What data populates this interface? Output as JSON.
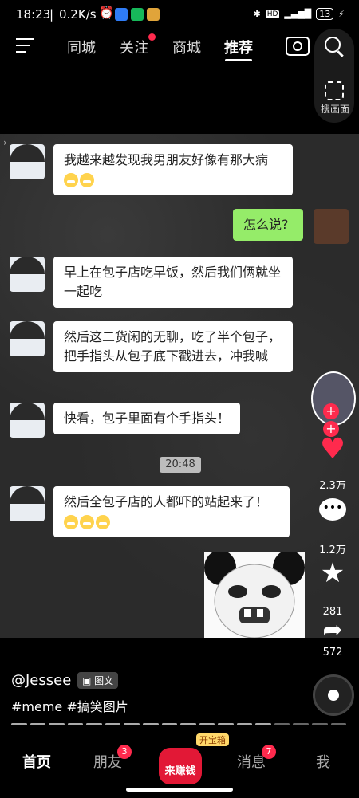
{
  "status_bar": {
    "time": "18:23",
    "speed": "0.2K/s",
    "battery": "13"
  },
  "top_nav": {
    "tabs": [
      {
        "label": "同城"
      },
      {
        "label": "关注"
      },
      {
        "label": "商城"
      },
      {
        "label": "推荐"
      }
    ],
    "active_tab": "推荐",
    "search_panel_label": "搜画面"
  },
  "chat": {
    "messages": [
      {
        "from": "other",
        "text": "我越来越发现我男朋友好像有那大病"
      },
      {
        "from": "me",
        "text": "怎么说?"
      },
      {
        "from": "other",
        "text": "早上在包子店吃早饭，然后我们俩就坐一起吃"
      },
      {
        "from": "other",
        "text": "然后这二货闲的无聊，吃了半个包子，把手指头从包子底下戳进去，冲我喊"
      },
      {
        "from": "other",
        "text": "快看，包子里面有个手指头！"
      },
      {
        "from": "other",
        "text": "然后全包子店的人都吓的站起来了！"
      }
    ],
    "timestamp": "20:48"
  },
  "side_actions": {
    "likes": "2.3万",
    "comments": "1.2万",
    "favorites": "281",
    "shares": "572"
  },
  "caption": {
    "author": "@Jessee",
    "type_badge": "图文",
    "tags": "#meme #搞笑图片"
  },
  "bottom_nav": {
    "items": [
      {
        "label": "首页"
      },
      {
        "label": "朋友",
        "badge": "3"
      },
      {
        "label": "消息",
        "badge": "7"
      },
      {
        "label": "我"
      }
    ],
    "earn_label": "来赚钱",
    "earn_tag": "开宝箱"
  },
  "colors": {
    "accent_red": "#ff2a4d",
    "chat_green": "#95ec69"
  }
}
